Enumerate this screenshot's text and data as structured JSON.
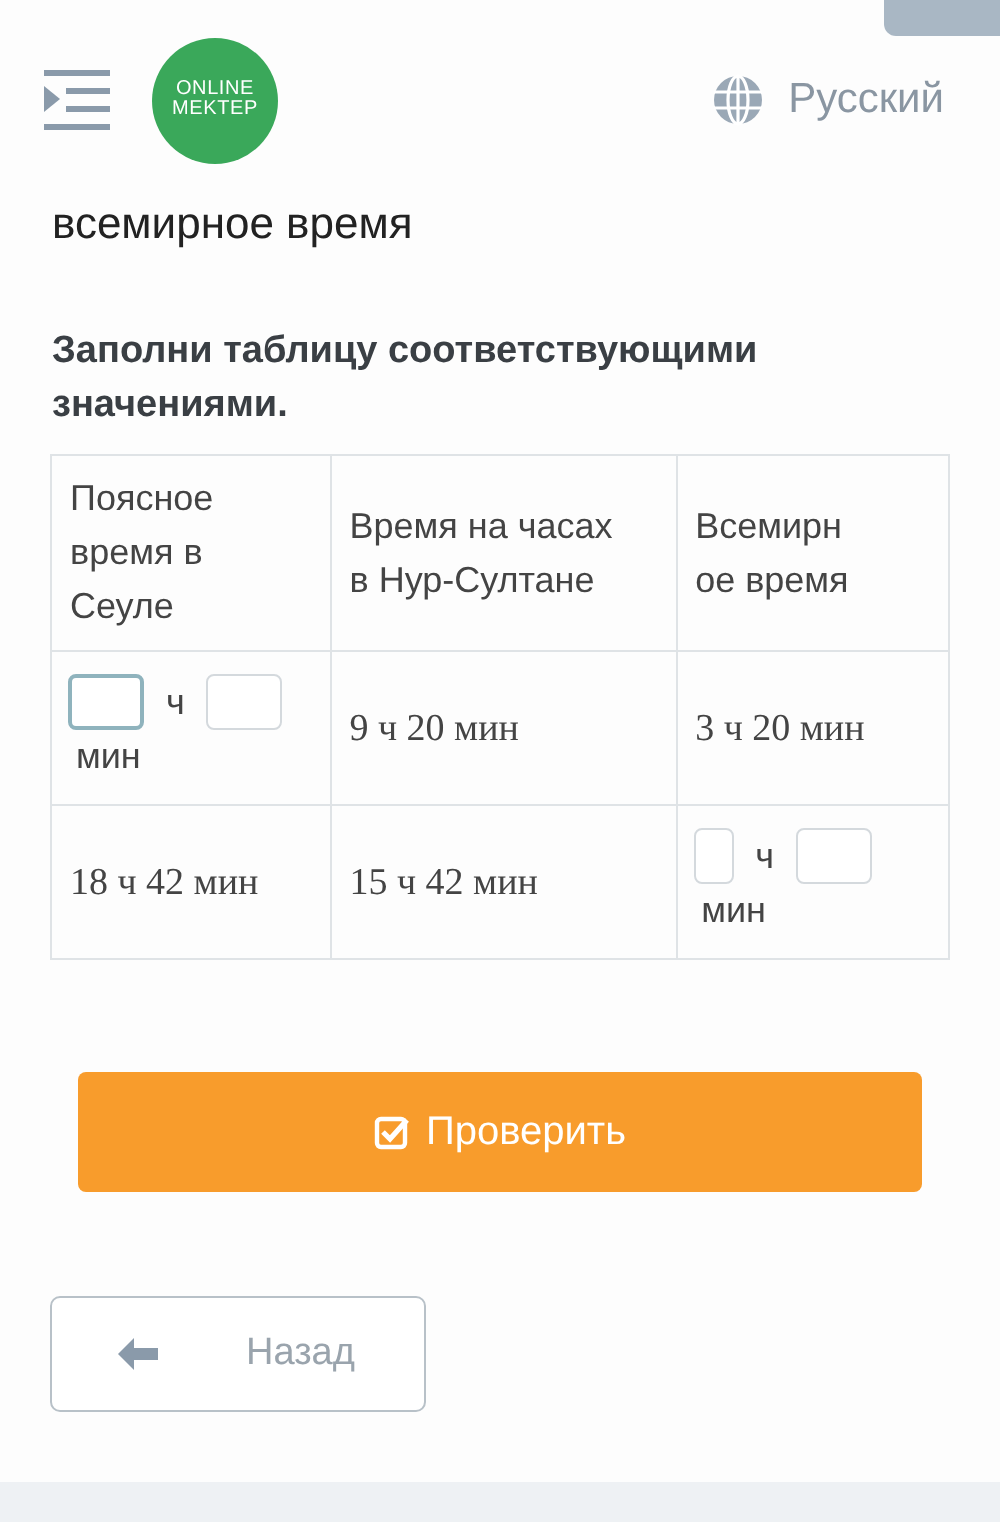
{
  "header": {
    "logo_lines": [
      "ONLINE",
      "MEKTEP"
    ],
    "language": "Русский"
  },
  "title": "всемирное время",
  "instruction": "Заполни таблицу соответствующими значениями.",
  "table": {
    "columns": [
      "Поясное время в Сеуле",
      "Время на часах в Нур-Султане",
      "Всемирное время"
    ],
    "rows": [
      [
        {
          "kind": "blanks",
          "hours_unit": "ч",
          "minutes_unit": "мин",
          "hours_focused": true,
          "minutes_focused": false
        },
        {
          "kind": "text",
          "text": "9 ч 20 мин"
        },
        {
          "kind": "text",
          "text": "3 ч 20 мин"
        }
      ],
      [
        {
          "kind": "text",
          "text": "18 ч 42 мин"
        },
        {
          "kind": "text",
          "text": "15 ч 42 мин"
        },
        {
          "kind": "blanks",
          "hours_unit": "ч",
          "minutes_unit": "мин",
          "hours_focused": false,
          "minutes_focused": false
        }
      ]
    ]
  },
  "check_button": "Проверить",
  "back_button": "Назад"
}
